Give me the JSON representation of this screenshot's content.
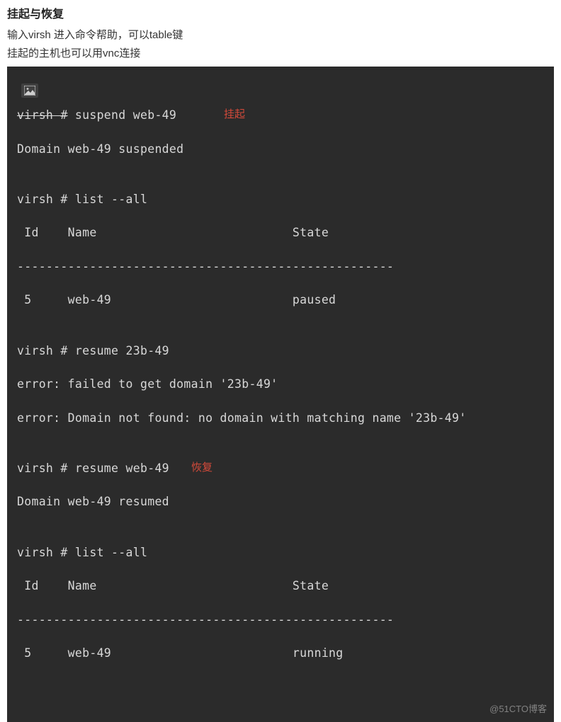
{
  "heading": "挂起与恢复",
  "desc1": "输入virsh 进入命令帮助，可以table键",
  "desc2": "挂起的主机也可以用vnc连接",
  "annot_suspend": "挂起",
  "annot_resume": "恢复",
  "watermark": "@51CTO博客",
  "term": {
    "l01a": "virsh #",
    "l01b": " suspend web-49",
    "l02": "Domain web-49 suspended",
    "l03": "",
    "l04": "virsh # list --all",
    "l05": " Id    Name                           State",
    "l06": "----------------------------------------------------",
    "l07": " 5     web-49                         paused",
    "l08": "",
    "l09": "virsh # resume 23b-49",
    "l10": "error: failed to get domain '23b-49'",
    "l11": "error: Domain not found: no domain with matching name '23b-49'",
    "l12": "",
    "l13": "virsh # resume web-49",
    "l14": "Domain web-49 resumed",
    "l15": "",
    "l16": "virsh # list --all",
    "l17": " Id    Name                           State",
    "l18": "----------------------------------------------------",
    "l19": " 5     web-49                         running"
  }
}
